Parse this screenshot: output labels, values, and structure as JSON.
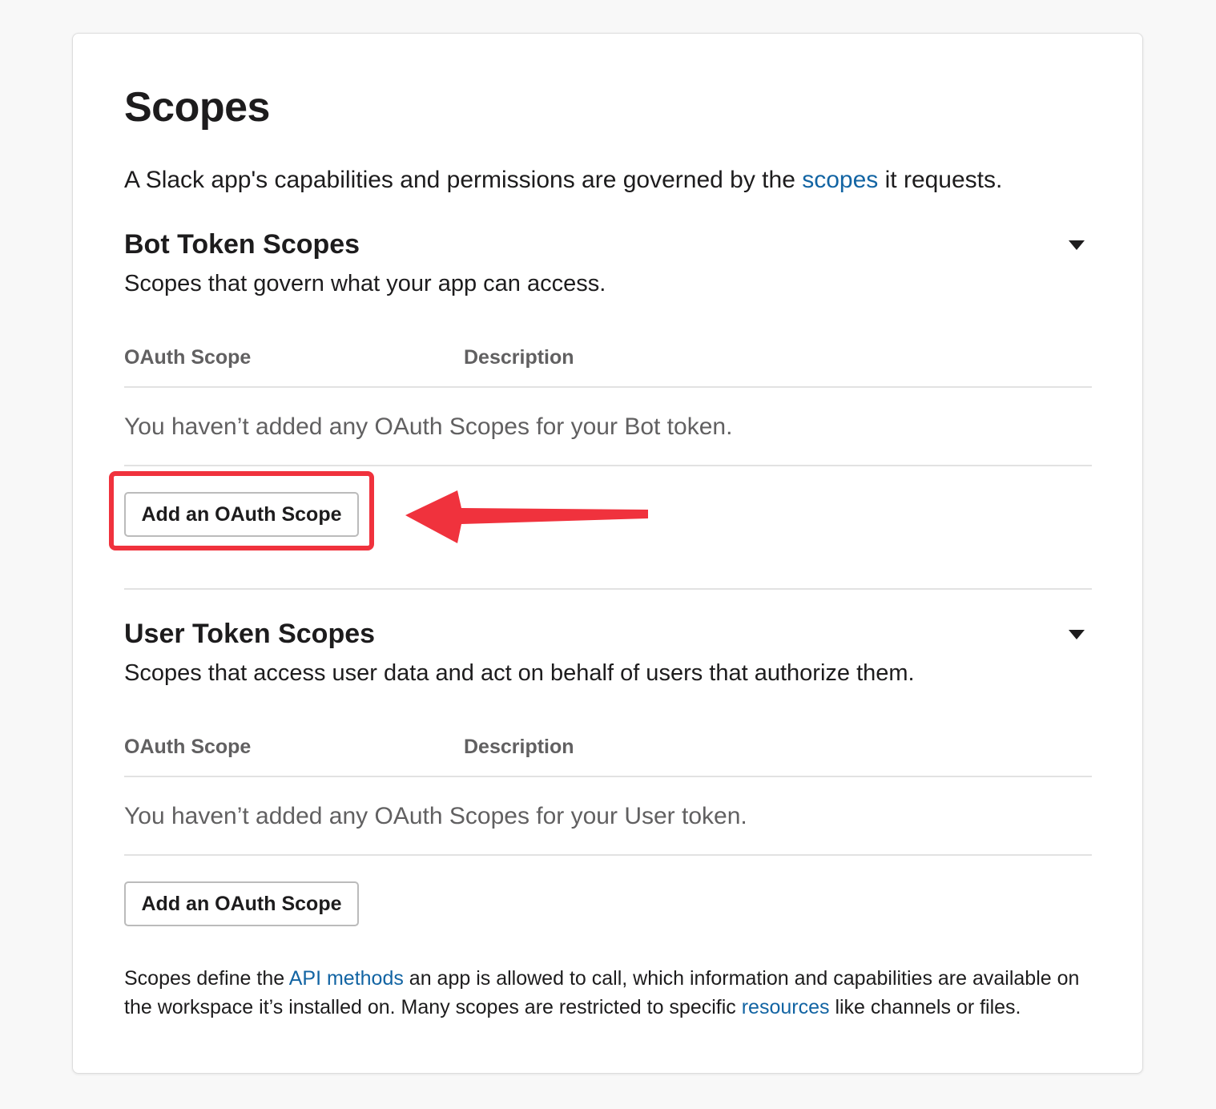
{
  "page": {
    "title": "Scopes",
    "intro_before": "A Slack app's capabilities and permissions are governed by the ",
    "intro_link": "scopes",
    "intro_after": " it requests."
  },
  "bot": {
    "title": "Bot Token Scopes",
    "subtitle": "Scopes that govern what your app can access.",
    "col_scope": "OAuth Scope",
    "col_description": "Description",
    "empty": "You haven’t added any OAuth Scopes for your Bot token.",
    "button": "Add an OAuth Scope"
  },
  "user": {
    "title": "User Token Scopes",
    "subtitle": "Scopes that access user data and act on behalf of users that authorize them.",
    "col_scope": "OAuth Scope",
    "col_description": "Description",
    "empty": "You haven’t added any OAuth Scopes for your User token.",
    "button": "Add an OAuth Scope"
  },
  "footer": {
    "text1": "Scopes define the ",
    "link1": "API methods",
    "text2": " an app is allowed to call, which information and capabilities are available on the workspace it’s installed on. Many scopes are restricted to specific ",
    "link2": "resources",
    "text3": " like channels or files."
  },
  "annotation": {
    "highlight_color": "#f0323d",
    "arrow_icon": "left-arrow-icon"
  },
  "colors": {
    "link": "#1264a3",
    "muted": "#616061",
    "text": "#1d1c1d"
  }
}
